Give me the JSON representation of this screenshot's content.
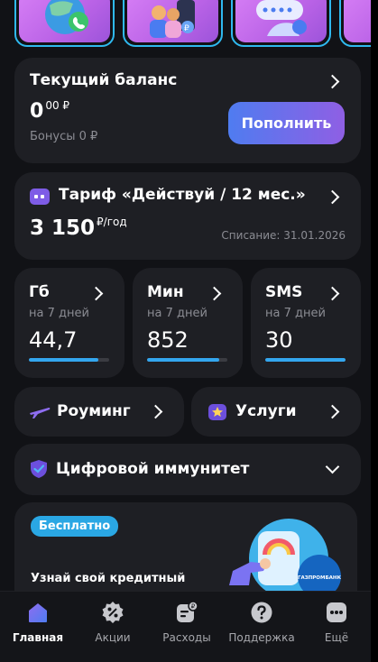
{
  "balance": {
    "title": "Текущий баланс",
    "amount_main": "0",
    "amount_cents": "00 ₽",
    "bonus": "Бонусы 0 ₽",
    "topup_label": "Пополнить"
  },
  "tariff": {
    "name": "Тариф «Действуй  / 12 мес.»",
    "price_main": "3 150",
    "price_unit": "₽/год",
    "charge": "Списание: 31.01.2026"
  },
  "counters": [
    {
      "title": "Гб",
      "period": "на 7 дней",
      "value": "44,7",
      "fill": 0.87
    },
    {
      "title": "Мин",
      "period": "на 7 дней",
      "value": "852",
      "fill": 0.9
    },
    {
      "title": "SMS",
      "period": "на 7 дней",
      "value": "30",
      "fill": 1.0
    }
  ],
  "roaming": {
    "label": "Роуминг"
  },
  "services": {
    "label": "Услуги"
  },
  "immunity": {
    "label": "Цифровой иммунитет"
  },
  "promo": {
    "badge": "Бесплатно",
    "text": "Узнай свой кредитный",
    "bank_logo": "ГАЗПРОМБАНК"
  },
  "tabs": [
    {
      "label": "Главная",
      "icon": "home-icon",
      "active": true
    },
    {
      "label": "Акции",
      "icon": "percent-icon",
      "active": false
    },
    {
      "label": "Расходы",
      "icon": "expenses-icon",
      "active": false
    },
    {
      "label": "Поддержка",
      "icon": "help-icon",
      "active": false
    },
    {
      "label": "Ещё",
      "icon": "more-icon",
      "active": false
    }
  ],
  "colors": {
    "accent_blue": "#33a6ee",
    "accent_purple": "#7e5ce6",
    "card_bg": "#1e1f24",
    "app_bg": "#111216"
  }
}
